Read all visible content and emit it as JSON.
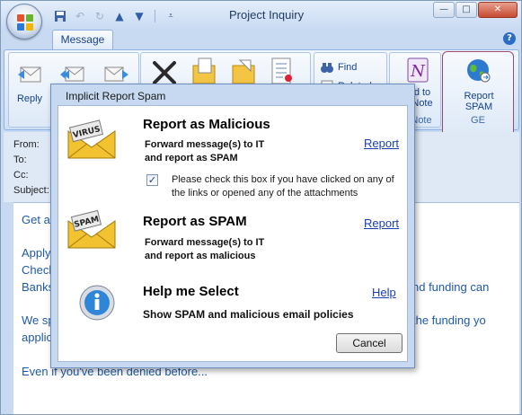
{
  "window": {
    "title": "Project Inquiry",
    "controls": {
      "minimize": "—",
      "maximize": "□",
      "close": "✕"
    }
  },
  "ribbon": {
    "tab": "Message",
    "help": "?",
    "reply_label": "Reply",
    "find_label": "Find",
    "related_label": "Related ▾",
    "add_to_note_label_1": "d to",
    "add_to_note_label_2": "Note",
    "add_to_note_group": "Note",
    "report_spam_label_1": "Report",
    "report_spam_label_2": "SPAM",
    "report_spam_group": "GE"
  },
  "header": {
    "from_label": "From:",
    "to_label": "To:",
    "cc_label": "Cc:",
    "subject_label": "Subject:"
  },
  "body": {
    "line1": "Get a",
    "line2": "Apply",
    "line3": "Check",
    "line4": "Banks",
    "line4_right": "nd funding can",
    "line5": "We sp",
    "line5_right": "the funding yo",
    "line6": "applic",
    "line7": "Even if you've been denied before..."
  },
  "dialog": {
    "title": "Implicit Report Spam",
    "options": [
      {
        "icon_text": "VIRUS",
        "title": "Report as Malicious",
        "desc_1": "Forward message(s) to IT",
        "desc_2": "and report as SPAM",
        "link": "Report"
      },
      {
        "icon_text": "SPAM",
        "title": "Report as SPAM",
        "desc_1": "Forward message(s) to IT",
        "desc_2": "and report as malicious",
        "link": "Report"
      },
      {
        "title": "Help me Select",
        "desc_1": "Show SPAM and malicious email policies",
        "link": "Help"
      }
    ],
    "checkbox": {
      "checked": true,
      "mark": "✓",
      "text": "Please check this box if you have clicked on any of the links or opened any of the attachments"
    },
    "cancel_label": "Cancel"
  },
  "colors": {
    "link": "#1c3fb8",
    "body_text": "#1f5aa6",
    "envelope": "#f2c230",
    "spam_group_border": "#9a4a6d"
  }
}
